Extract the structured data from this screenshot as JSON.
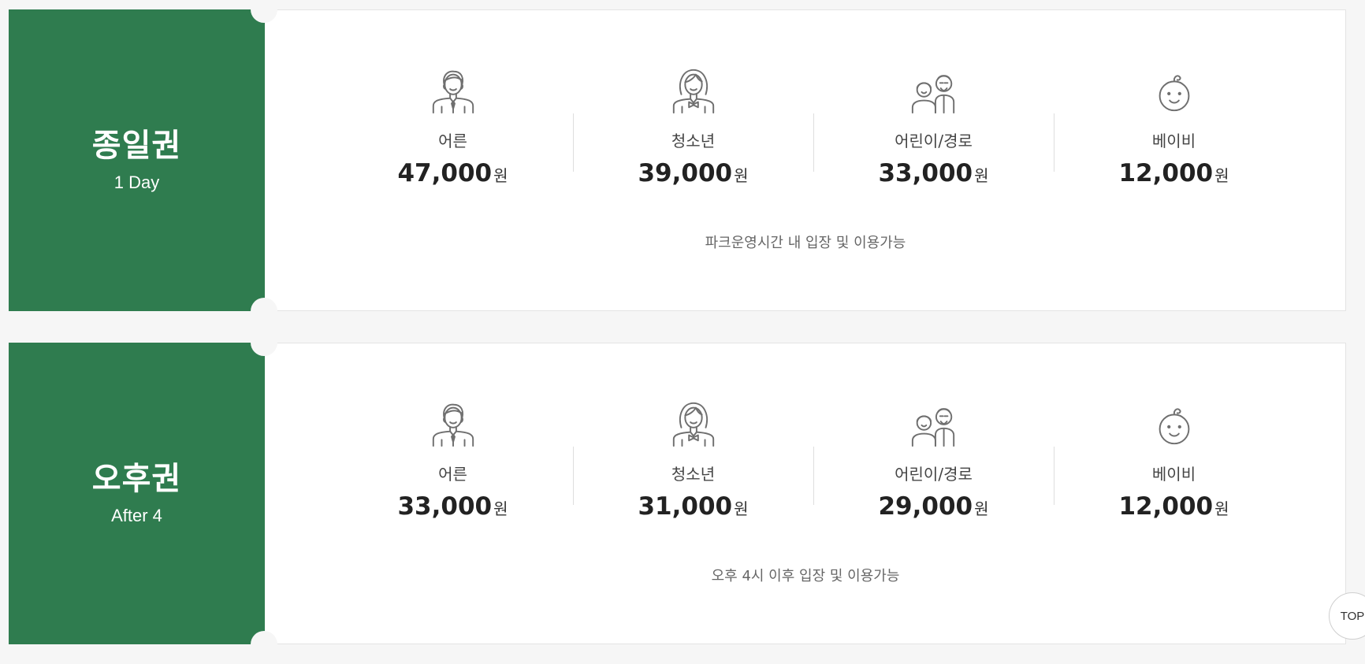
{
  "tickets": [
    {
      "title": "종일권",
      "subtitle": "1 Day",
      "note": "파크운영시간 내 입장 및 이용가능",
      "prices": [
        {
          "icon": "man-icon",
          "label": "어른",
          "amount": "47,000",
          "unit": "원"
        },
        {
          "icon": "girl-icon",
          "label": "청소년",
          "amount": "39,000",
          "unit": "원"
        },
        {
          "icon": "child-senior-icon",
          "label": "어린이/경로",
          "amount": "33,000",
          "unit": "원"
        },
        {
          "icon": "baby-icon",
          "label": "베이비",
          "amount": "12,000",
          "unit": "원"
        }
      ]
    },
    {
      "title": "오후권",
      "subtitle": "After 4",
      "note": "오후 4시 이후 입장 및 이용가능",
      "prices": [
        {
          "icon": "man-icon",
          "label": "어른",
          "amount": "33,000",
          "unit": "원"
        },
        {
          "icon": "girl-icon",
          "label": "청소년",
          "amount": "31,000",
          "unit": "원"
        },
        {
          "icon": "child-senior-icon",
          "label": "어린이/경로",
          "amount": "29,000",
          "unit": "원"
        },
        {
          "icon": "baby-icon",
          "label": "베이비",
          "amount": "12,000",
          "unit": "원"
        }
      ]
    }
  ],
  "top_button": {
    "label": "TOP"
  },
  "colors": {
    "accent": "#2f7c4f",
    "background": "#f6f6f6",
    "icon_stroke": "#6f6f6f"
  }
}
